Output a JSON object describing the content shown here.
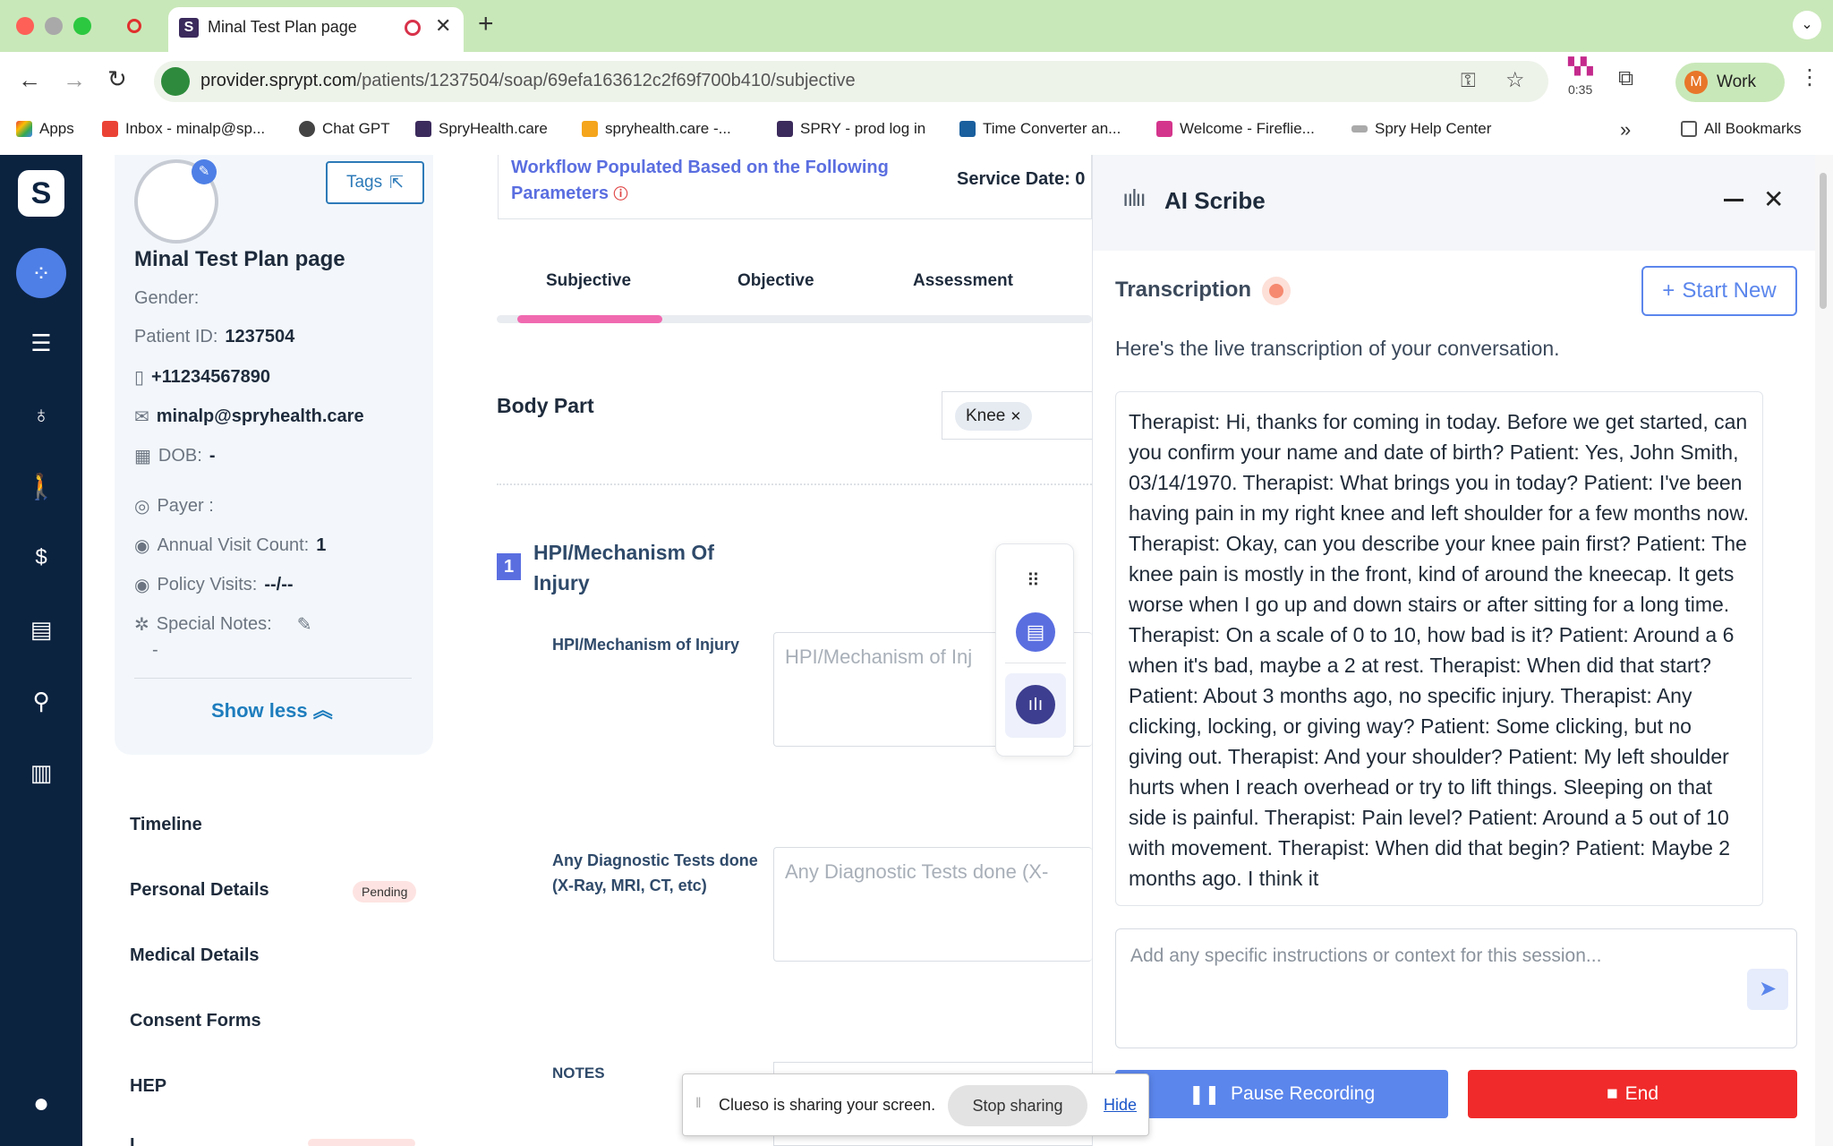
{
  "browser": {
    "tab_title": "Minal Test Plan page",
    "url_host": "provider.sprypt.com",
    "url_path": "/patients/1237504/soap/69efa163612c2f69f700b410/subjective",
    "cast_timer": "0:35",
    "profile_initial": "M",
    "profile_label": "Work",
    "bookmarks": [
      "Apps",
      "Inbox - minalp@sp...",
      "Chat GPT",
      "SpryHealth.care",
      "spryhealth.care -...",
      "SPRY - prod log in",
      "Time Converter an...",
      "Welcome - Fireflie...",
      "Spry Help Center"
    ],
    "all_bookmarks": "All Bookmarks"
  },
  "patient": {
    "tags_label": "Tags",
    "name": "Minal Test Plan page",
    "gender_label": "Gender:",
    "patient_id_label": "Patient ID:",
    "patient_id": "1237504",
    "phone": "+11234567890",
    "email": "minalp@spryhealth.care",
    "dob_label": "DOB:",
    "dob": "-",
    "payer_label": "Payer :",
    "annual_visit_label": "Annual Visit Count:",
    "annual_visit": "1",
    "policy_visits_label": "Policy Visits:",
    "policy_visits": "--/--",
    "special_notes_label": "Special Notes:",
    "special_notes": "-",
    "show_less": "Show less"
  },
  "side_links": {
    "timeline": "Timeline",
    "personal_details": "Personal Details",
    "pending_badge": "Pending",
    "medical_details": "Medical Details",
    "consent_forms": "Consent Forms",
    "hep": "HEP",
    "partial": "I"
  },
  "soap": {
    "workflow_banner": "Workflow Populated Based on the Following Parameters",
    "service_date": "Service Date: 0",
    "tabs": [
      "Subjective",
      "Objective",
      "Assessment"
    ],
    "body_part_label": "Body Part",
    "body_part_chip": "Knee",
    "section_number": "1",
    "section_title": "HPI/Mechanism Of Injury",
    "hpi_label": "HPI/Mechanism of Injury",
    "hpi_placeholder": "HPI/Mechanism of Inj",
    "diag_label": "Any Diagnostic Tests done (X-Ray, MRI, CT, etc)",
    "diag_placeholder": "Any Diagnostic Tests done (X-",
    "notes_label": "NOTES"
  },
  "scribe": {
    "title": "AI Scribe",
    "transcription_label": "Transcription",
    "start_new": "Start New",
    "subtitle": "Here's the live transcription of your conversation.",
    "transcript": "Therapist: Hi, thanks for coming in today. Before we get started, can you confirm your name and date of birth? Patient: Yes, John Smith, 03/14/1970. Therapist: What brings you in today? Patient: I've been having pain in my right knee and left shoulder for a few months now. Therapist: Okay, can you describe your knee pain first? Patient: The knee pain is mostly in the front, kind of around the kneecap. It gets worse when I go up and down stairs or after sitting for a long time. Therapist: On a scale of 0 to 10, how bad is it? Patient: Around a 6 when it's bad, maybe a 2 at rest. Therapist: When did that start? Patient: About 3 months ago, no specific injury. Therapist: Any clicking, locking, or giving way? Patient: Some clicking, but no giving out. Therapist: And your shoulder? Patient: My left shoulder hurts when I reach overhead or try to lift things. Sleeping on that side is painful. Therapist: Pain level? Patient: Around a 5 out of 10 with movement. Therapist: When did that begin? Patient: Maybe 2 months ago. I think it",
    "instructions_placeholder": "Add any specific instructions or context for this session...",
    "pause_label": "Pause Recording",
    "end_label": "End"
  },
  "share_bar": {
    "message": "Clueso is sharing your screen.",
    "stop": "Stop sharing",
    "hide": "Hide"
  },
  "colors": {
    "nav_bg": "#0c2340",
    "accent_blue": "#2f6fd6",
    "pink": "#f06ab0",
    "end_red": "#f02a2a",
    "pause_blue": "#5b86ec"
  }
}
